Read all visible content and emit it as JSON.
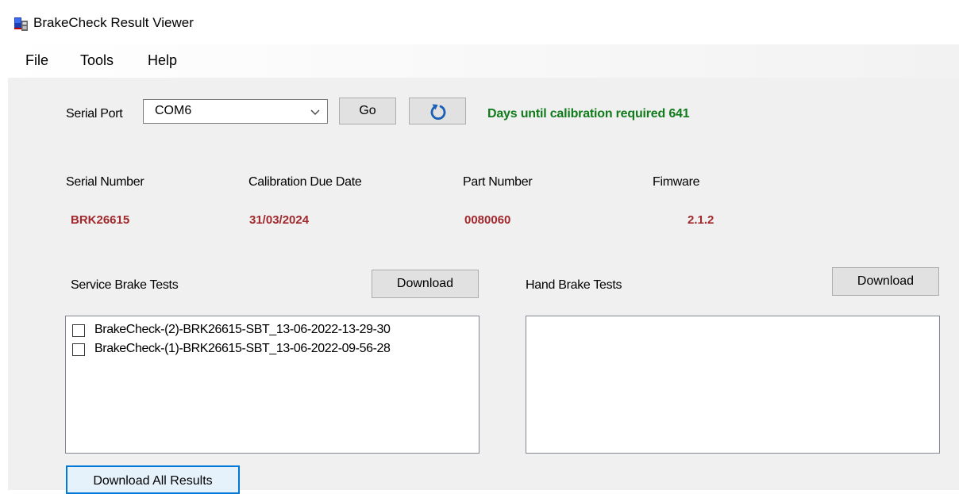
{
  "window": {
    "title": "BrakeCheck Result Viewer",
    "icon": "app-icon"
  },
  "menu": [
    "File",
    "Tools",
    "Help"
  ],
  "serial_port": {
    "label": "Serial Port",
    "value": "COM6",
    "go_label": "Go",
    "refresh_icon": "refresh-icon",
    "calibration_message": "Days until calibration required 641"
  },
  "device": {
    "serial_number_label": "Serial Number",
    "serial_number": "BRK26615",
    "calibration_due_label": "Calibration Due Date",
    "calibration_due": "31/03/2024",
    "part_number_label": "Part Number",
    "part_number": "0080060",
    "firmware_label": "Fimware",
    "firmware": "2.1.2"
  },
  "service_brake": {
    "label": "Service Brake Tests",
    "download_label": "Download",
    "items": [
      "BrakeCheck-(2)-BRK26615-SBT_13-06-2022-13-29-30",
      "BrakeCheck-(1)-BRK26615-SBT_13-06-2022-09-56-28"
    ]
  },
  "hand_brake": {
    "label": "Hand Brake Tests",
    "download_label": "Download",
    "items": []
  },
  "download_all_label": "Download All Results",
  "colors": {
    "value_text": "#a1282d",
    "calibration_text": "#117a1b",
    "client_bg": "#f0f0f0",
    "focus_border": "#0078d7"
  }
}
